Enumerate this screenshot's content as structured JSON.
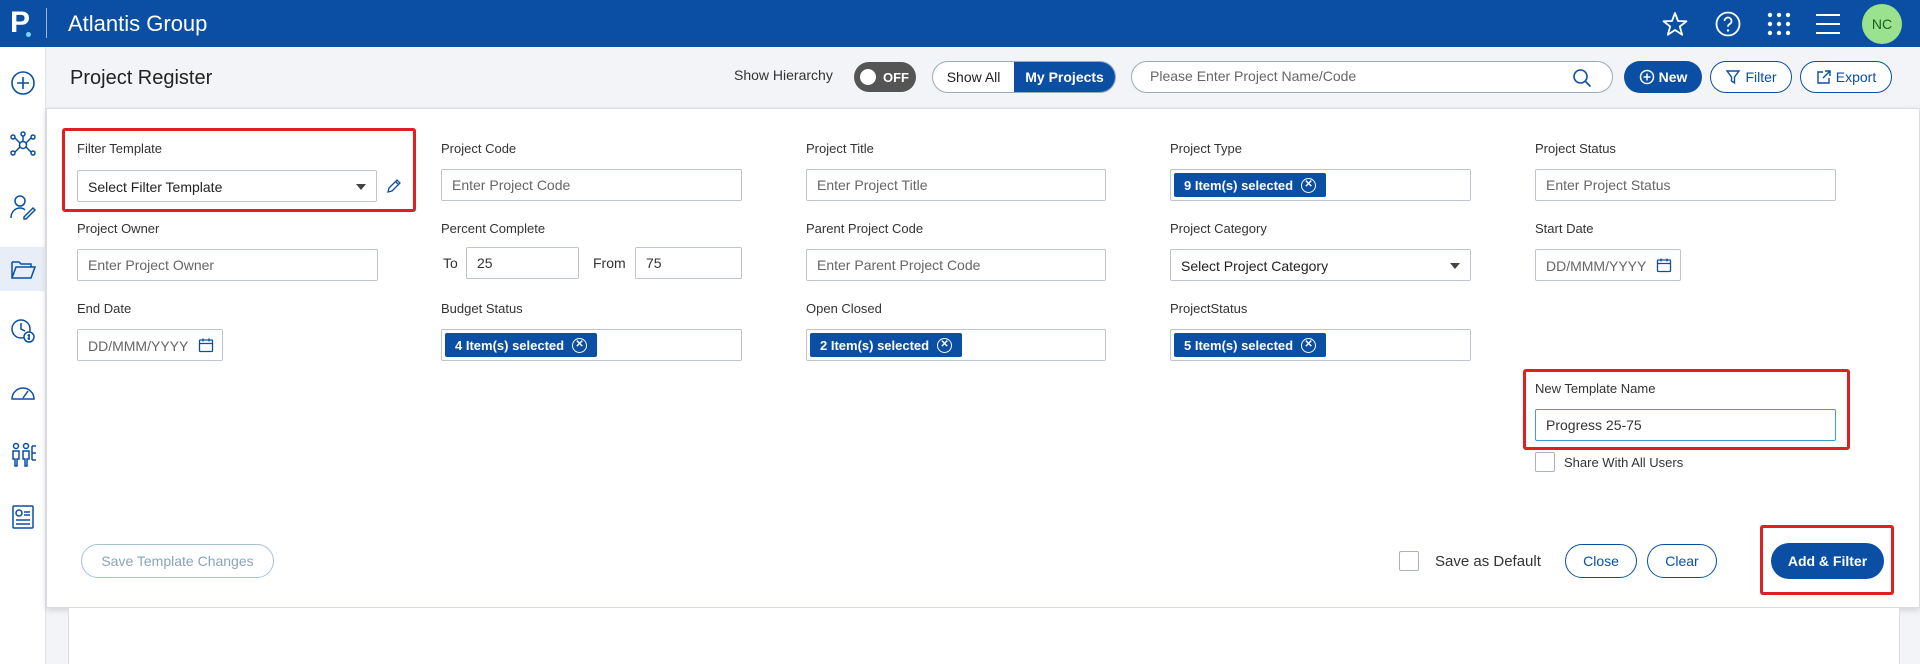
{
  "header": {
    "logo_letter": "P",
    "app_title": "Atlantis Group",
    "avatar_initials": "NC",
    "icons": [
      "star-icon",
      "help-icon",
      "apps-grid-icon",
      "menu-icon"
    ]
  },
  "rail": {
    "icons": [
      "add-icon",
      "network-icon",
      "user-edit-icon",
      "folder-icon",
      "clock-cost-icon",
      "dashboard-icon",
      "org-chart-icon",
      "report-icon"
    ],
    "active": "folder-icon"
  },
  "page": {
    "title": "Project Register",
    "show_hierarchy_label": "Show Hierarchy",
    "toggle_state": "OFF",
    "segment": {
      "show_all": "Show All",
      "my_projects": "My Projects",
      "selected": "My Projects"
    },
    "search_placeholder": "Please Enter Project Name/Code",
    "new_label": "New",
    "filter_label": "Filter",
    "export_label": "Export"
  },
  "filters": {
    "filter_template": {
      "label": "Filter Template",
      "value": "Select Filter Template"
    },
    "project_code": {
      "label": "Project Code",
      "placeholder": "Enter Project Code"
    },
    "project_title": {
      "label": "Project Title",
      "placeholder": "Enter Project Title"
    },
    "project_type": {
      "label": "Project Type",
      "chip": "9 Item(s) selected"
    },
    "project_status": {
      "label": "Project Status",
      "placeholder": "Enter Project Status"
    },
    "project_owner": {
      "label": "Project Owner",
      "placeholder": "Enter Project Owner"
    },
    "percent_complete": {
      "label": "Percent Complete",
      "to_label": "To",
      "to_value": "25",
      "from_label": "From",
      "from_value": "75"
    },
    "parent_project_code": {
      "label": "Parent Project Code",
      "placeholder": "Enter Parent Project Code"
    },
    "project_category": {
      "label": "Project Category",
      "value": "Select Project Category"
    },
    "start_date": {
      "label": "Start Date",
      "placeholder": "DD/MMM/YYYY"
    },
    "end_date": {
      "label": "End Date",
      "placeholder": "DD/MMM/YYYY"
    },
    "budget_status": {
      "label": "Budget Status",
      "chip": "4 Item(s) selected"
    },
    "open_closed": {
      "label": "Open Closed",
      "chip": "2 Item(s) selected"
    },
    "project_status_2": {
      "label": "ProjectStatus",
      "chip": "5 Item(s) selected"
    },
    "new_template_name": {
      "label": "New Template Name",
      "value": "Progress 25-75"
    },
    "share_with_all": {
      "label": "Share With All Users",
      "checked": false
    }
  },
  "footer": {
    "save_template_changes": "Save Template Changes",
    "save_as_default": "Save as Default",
    "close": "Close",
    "clear": "Clear",
    "add_and_filter": "Add & Filter"
  },
  "colors": {
    "brand": "#0a4fa3",
    "highlight": "#e02020",
    "avatar": "#9be28f"
  }
}
